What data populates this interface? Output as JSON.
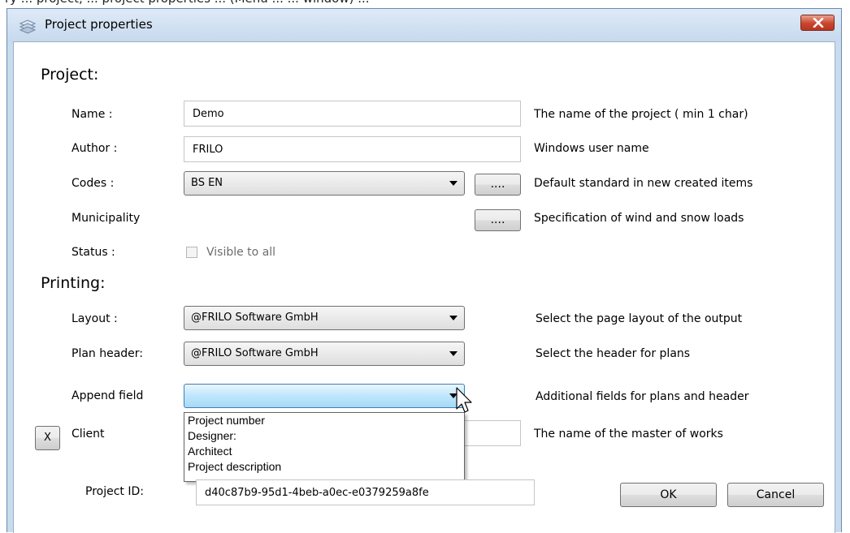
{
  "window": {
    "title": "Project properties"
  },
  "project": {
    "heading": "Project:",
    "name_label": "Name :",
    "name_value": "Demo",
    "name_hint": "The name of the project ( min 1 char)",
    "author_label": "Author :",
    "author_value": "FRILO",
    "author_hint": "Windows user name",
    "codes_label": "Codes :",
    "codes_value": "BS EN",
    "codes_button": "....",
    "codes_hint": "Default standard in new created  items",
    "municipality_label": "Municipality",
    "municipality_button": "....",
    "municipality_hint": "Specification of wind and snow loads",
    "status_label": "Status :",
    "status_checkbox_label": "Visible to all",
    "status_checked": false
  },
  "printing": {
    "heading": "Printing:",
    "layout_label": "Layout :",
    "layout_value": "@FRILO Software GmbH",
    "layout_hint": "Select the page layout of the output",
    "plan_header_label": "Plan header:",
    "plan_header_value": "@FRILO Software GmbH",
    "plan_header_hint": "Select the header for plans",
    "append_label": "Append field",
    "append_value": "",
    "append_hint": "Additional fields for plans and header",
    "append_options": [
      "Project number",
      "Designer:",
      "Architect",
      "Project description"
    ],
    "client_remove_button": "X",
    "client_label": "Client",
    "client_value": "",
    "client_hint": "The name of the master of works"
  },
  "footer": {
    "project_id_label": "Project ID:",
    "project_id_value": "d40c87b9-95d1-4beb-a0ec-e0379259a8fe",
    "ok_button": "OK",
    "cancel_button": "Cancel"
  },
  "icons": {
    "app": "stacked-layers-icon",
    "close": "close-icon",
    "dropdown": "chevron-down-icon",
    "cursor": "mouse-pointer-icon"
  },
  "colors": {
    "titlebar": "#c7d9ee",
    "close_button": "#c8452e",
    "active_combo": "#bee6fd"
  }
}
